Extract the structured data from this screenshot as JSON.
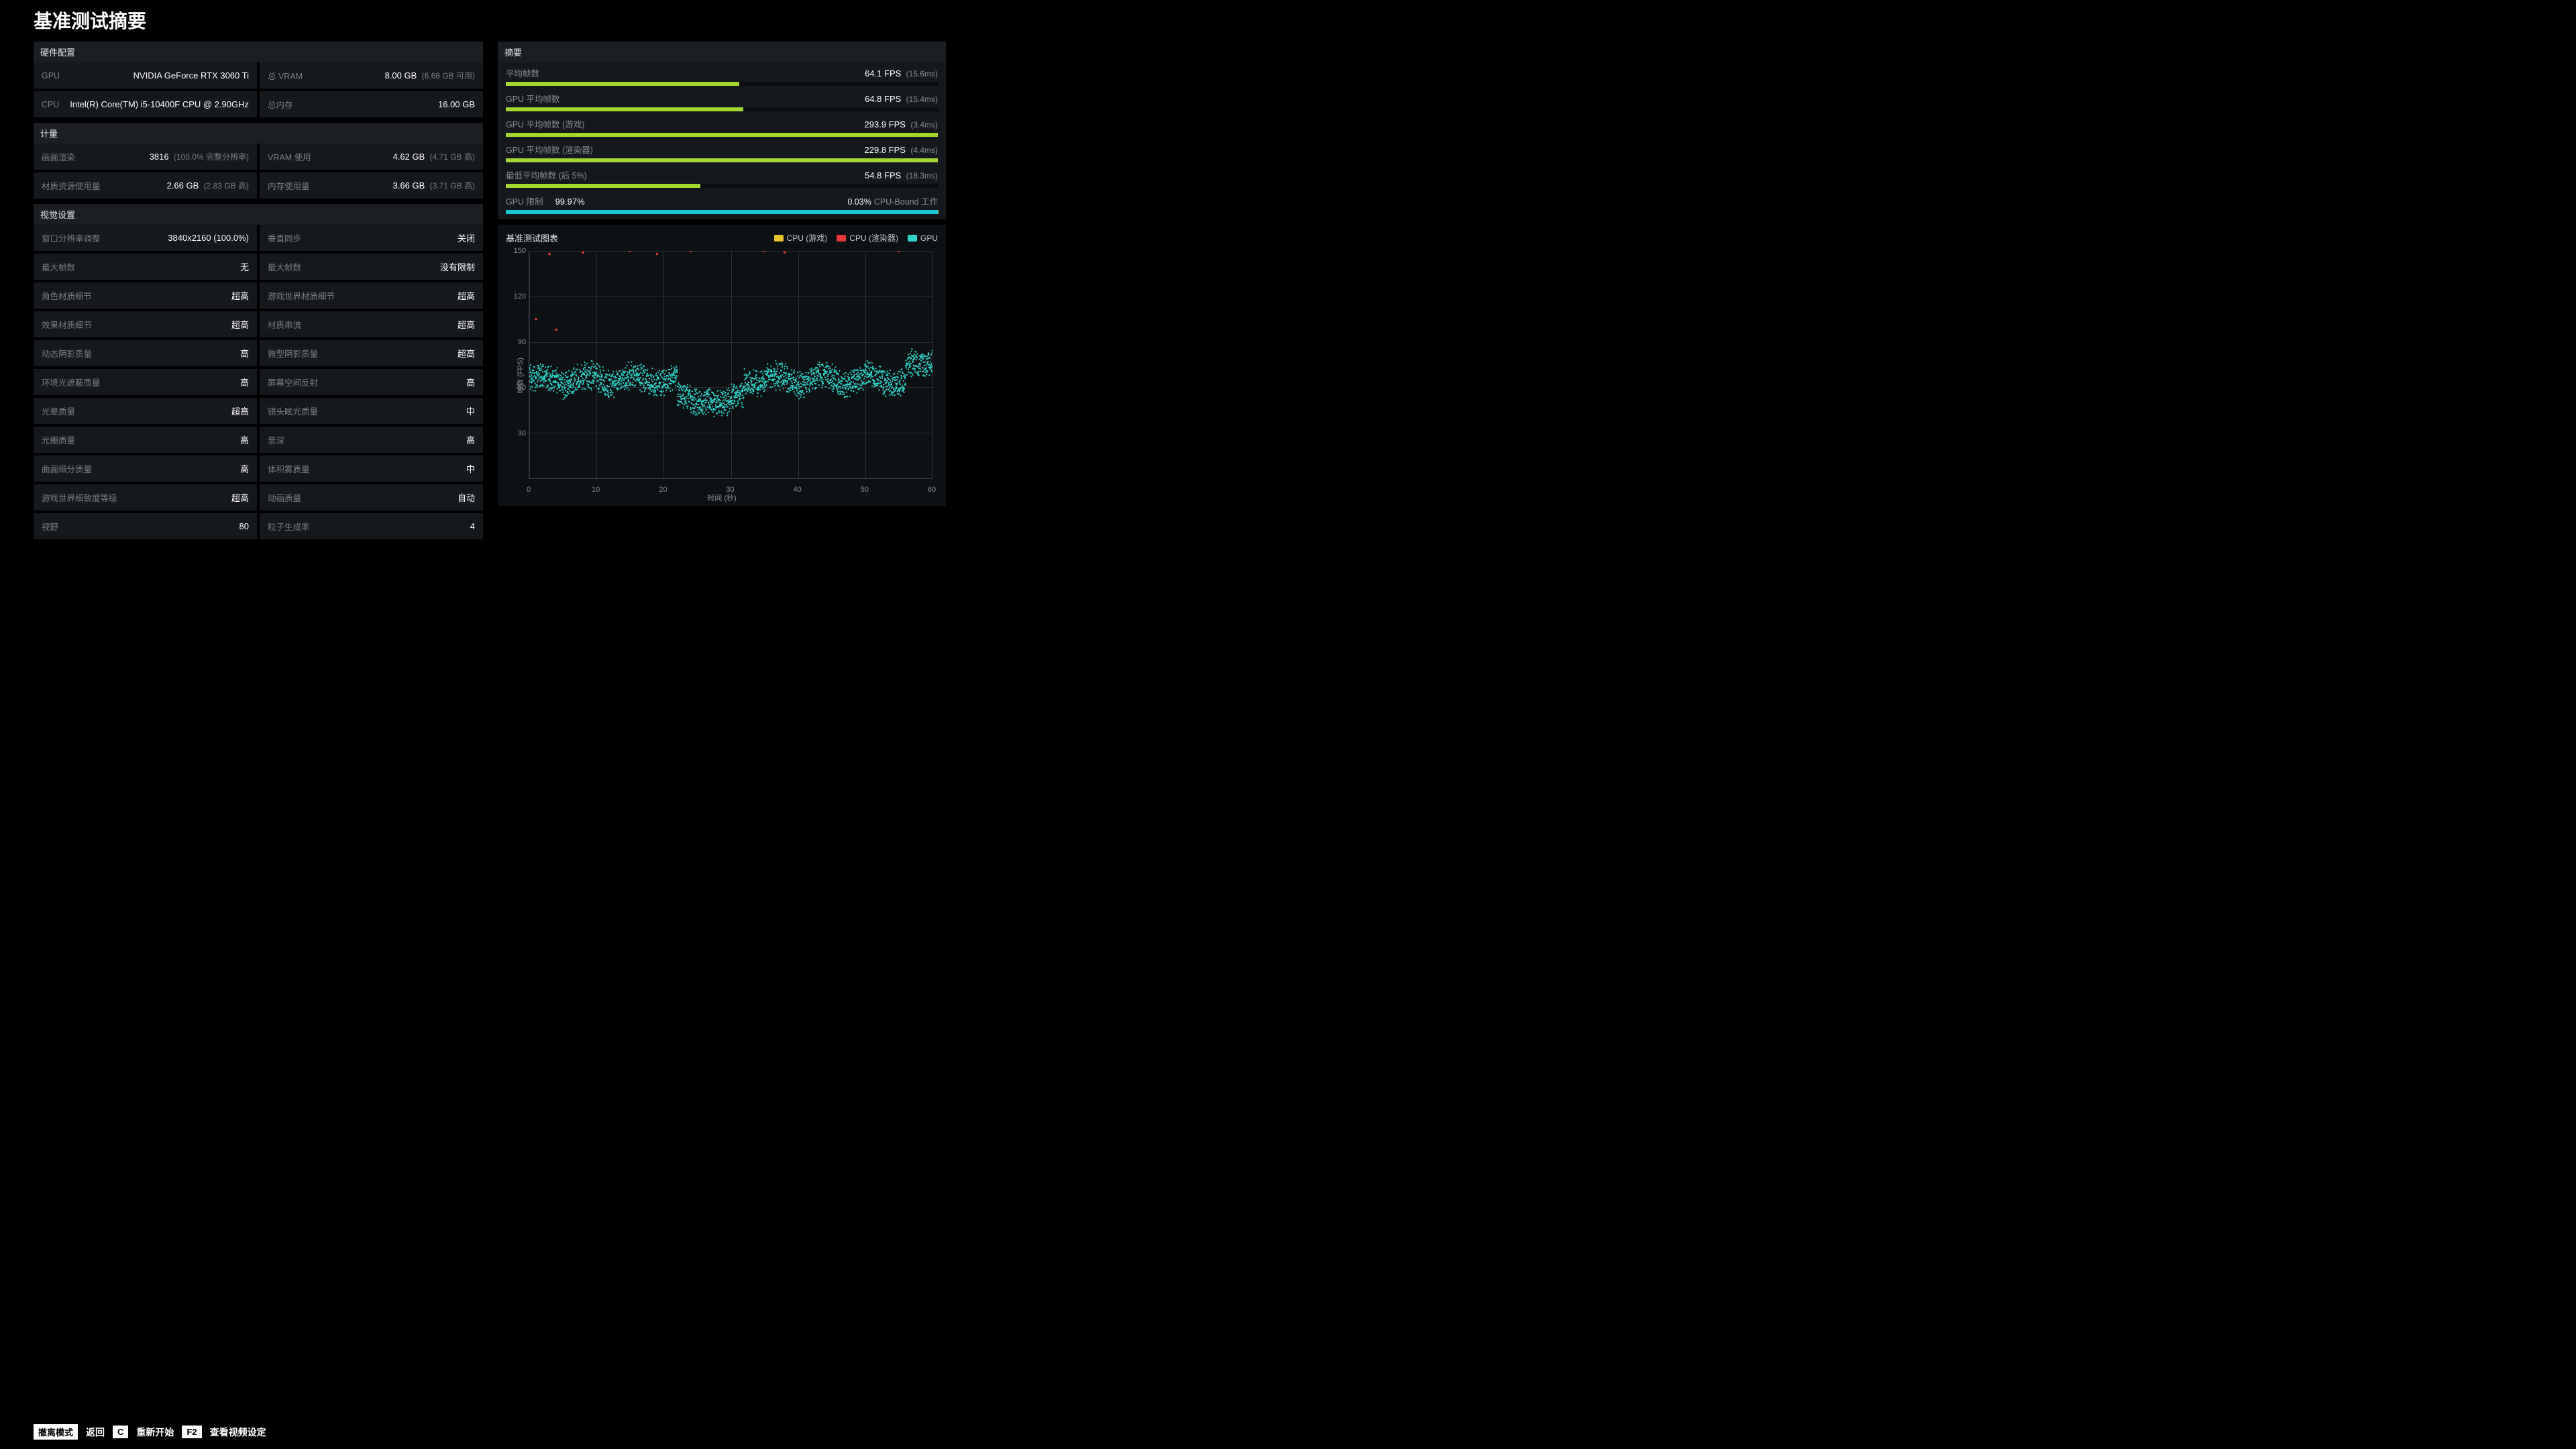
{
  "title": "基准测试摘要",
  "sections": {
    "hardware": "硬件配置",
    "metrics": "计量",
    "visual": "视觉设置",
    "summary": "摘要",
    "chart": "基准测试图表"
  },
  "hardware": [
    {
      "label": "GPU",
      "value": "NVIDIA GeForce RTX 3060 Ti",
      "sub": ""
    },
    {
      "label": "总 VRAM",
      "value": "8.00 GB",
      "sub": "(6.68 GB 可用)"
    },
    {
      "label": "CPU",
      "value": "Intel(R) Core(TM) i5-10400F CPU @ 2.90GHz",
      "sub": ""
    },
    {
      "label": "总内存",
      "value": "16.00 GB",
      "sub": ""
    }
  ],
  "metrics": [
    {
      "label": "画面渲染",
      "value": "3816",
      "sub": "(100.0% 完整分辨率)"
    },
    {
      "label": "VRAM 使用",
      "value": "4.62 GB",
      "sub": "(4.71 GB 高)"
    },
    {
      "label": "材质资源使用量",
      "value": "2.66 GB",
      "sub": "(2.83 GB 高)"
    },
    {
      "label": "内存使用量",
      "value": "3.66 GB",
      "sub": "(3.71 GB 高)"
    }
  ],
  "visual": [
    {
      "label": "窗口分辨率调整",
      "value": "3840x2160 (100.0%)"
    },
    {
      "label": "垂直同步",
      "value": "关闭"
    },
    {
      "label": "最大帧数",
      "value": "无"
    },
    {
      "label": "最大帧数",
      "value": "没有限制"
    },
    {
      "label": "角色材质细节",
      "value": "超高"
    },
    {
      "label": "游戏世界材质细节",
      "value": "超高"
    },
    {
      "label": "效果材质细节",
      "value": "超高"
    },
    {
      "label": "材质串流",
      "value": "超高"
    },
    {
      "label": "动态阴影质量",
      "value": "高"
    },
    {
      "label": "微型阴影质量",
      "value": "超高"
    },
    {
      "label": "环境光遮蔽质量",
      "value": "高"
    },
    {
      "label": "屏幕空间反射",
      "value": "高"
    },
    {
      "label": "光晕质量",
      "value": "超高"
    },
    {
      "label": "镜头眩光质量",
      "value": "中"
    },
    {
      "label": "光栅质量",
      "value": "高"
    },
    {
      "label": "景深",
      "value": "高"
    },
    {
      "label": "曲面细分质量",
      "value": "高"
    },
    {
      "label": "体积雾质量",
      "value": "中"
    },
    {
      "label": "游戏世界细致度等级",
      "value": "超高"
    },
    {
      "label": "动画质量",
      "value": "自动"
    },
    {
      "label": "视野",
      "value": "80"
    },
    {
      "label": "粒子生成率",
      "value": "4"
    }
  ],
  "summary": [
    {
      "label": "平均帧数",
      "value": "64.1 FPS",
      "sub": "(15.6ms)",
      "pct": 54
    },
    {
      "label": "GPU 平均帧数",
      "value": "64.8 FPS",
      "sub": "(15.4ms)",
      "pct": 55
    },
    {
      "label": "GPU 平均帧数 (游戏)",
      "value": "293.9 FPS",
      "sub": "(3.4ms)",
      "pct": 100
    },
    {
      "label": "GPU 平均帧数 (渲染器)",
      "value": "229.8 FPS",
      "sub": "(4.4ms)",
      "pct": 100
    },
    {
      "label": "最低平均帧数 (后 5%)",
      "value": "54.8 FPS",
      "sub": "(18.3ms)",
      "pct": 45
    }
  ],
  "bound": {
    "left_label": "GPU 限制",
    "left_pct": "99.97%",
    "right_pct": "0.03%",
    "right_label": "CPU-Bound 工作"
  },
  "legend": {
    "cpu_game": "CPU (游戏)",
    "cpu_render": "CPU (渲染器)",
    "gpu": "GPU"
  },
  "chart_axes": {
    "ylabel": "帧数 (FPS)",
    "xlabel": "时间 (秒)",
    "ymin": 0,
    "ymax": 150,
    "yticks": [
      30,
      60,
      90,
      120,
      150
    ],
    "xmin": 0,
    "xmax": 60,
    "xticks": [
      0,
      10,
      20,
      30,
      40,
      50,
      60
    ]
  },
  "chart_data": {
    "type": "scatter",
    "xlabel": "时间 (秒)",
    "ylabel": "帧数 (FPS)",
    "xlim": [
      0,
      60
    ],
    "ylim": [
      0,
      150
    ],
    "series": [
      {
        "name": "GPU",
        "color": "#2dd6c9",
        "note": "dense per-frame samples; values mostly 55–80 FPS across 0–60s, dip to ~45–55 around 25–30s, rise to ~75–82 near 58–60s",
        "approx_band": {
          "low": 50,
          "high": 78
        }
      },
      {
        "name": "CPU (渲染器)",
        "color": "#e83a3a",
        "note": "sparse points near top",
        "points": [
          {
            "x": 3,
            "y": 148
          },
          {
            "x": 8,
            "y": 149
          },
          {
            "x": 15,
            "y": 150
          },
          {
            "x": 19,
            "y": 148
          },
          {
            "x": 24,
            "y": 150
          },
          {
            "x": 35,
            "y": 150
          },
          {
            "x": 38,
            "y": 149
          },
          {
            "x": 55,
            "y": 150
          },
          {
            "x": 1,
            "y": 105
          },
          {
            "x": 4,
            "y": 98
          }
        ]
      },
      {
        "name": "CPU (游戏)",
        "color": "#e8c22d",
        "note": "not visibly distinguishable; overlaps red at top",
        "points": []
      }
    ]
  },
  "footer": {
    "k1": "撤离模式",
    "a1": "返回",
    "k2": "C",
    "a2": "重新开始",
    "k3": "F2",
    "a3": "查看视频设定"
  }
}
